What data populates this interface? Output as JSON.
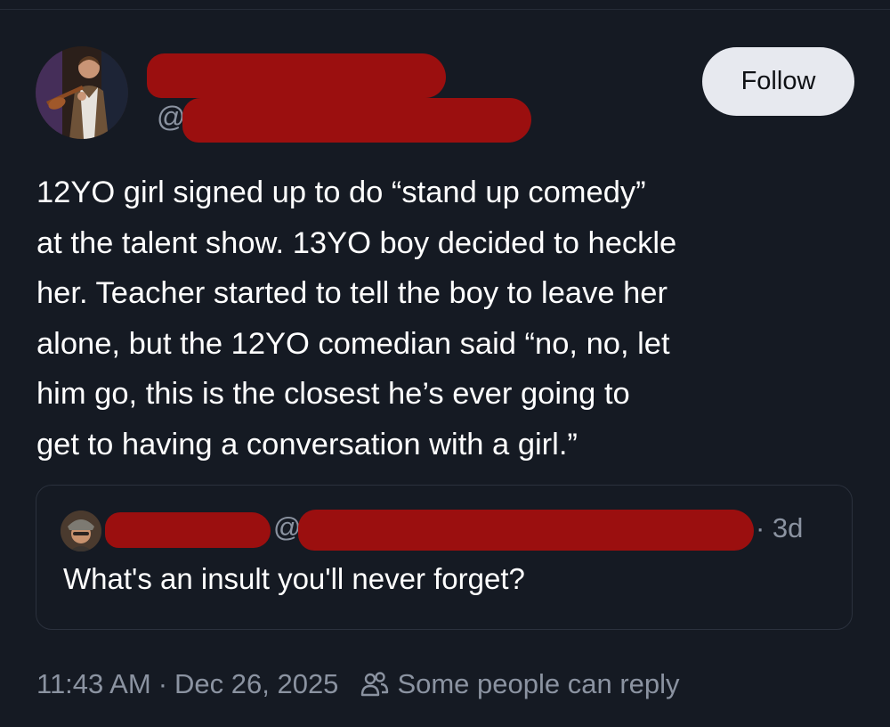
{
  "author": {
    "handle_prefix": "@"
  },
  "follow_label": "Follow",
  "post": {
    "lines": [
      "12YO girl signed up to do “stand up comedy”",
      "at the talent show. 13YO boy decided to heckle",
      "her. Teacher started to tell the boy to leave her",
      "alone, but the 12YO comedian said “no, no, let",
      "him go, this is the closest he’s ever going to",
      "get to having a conversation with a girl.”"
    ]
  },
  "quoted": {
    "handle_prefix": "@",
    "time": "· 3d",
    "text": "What's an insult you'll never forget?"
  },
  "meta": {
    "time": "11:43 AM",
    "separator": "·",
    "date": "Dec 26, 2025",
    "reply_setting": "Some people can reply",
    "reply_icon": "people-icon"
  },
  "colors": {
    "background": "#151a23",
    "redaction": "#9b0f0f",
    "muted_text": "#8b93a1",
    "follow_button_bg": "#e7e9ef"
  }
}
